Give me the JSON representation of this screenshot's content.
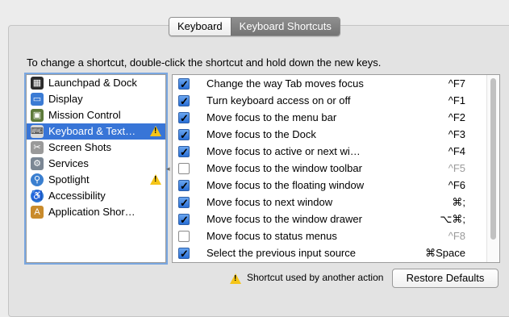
{
  "tabs": [
    {
      "label": "Keyboard",
      "active": false
    },
    {
      "label": "Keyboard Shortcuts",
      "active": true
    }
  ],
  "instruction": "To change a shortcut, double-click the shortcut and hold down the new keys.",
  "sidebar": {
    "items": [
      {
        "label": "Launchpad & Dock",
        "icon": "launchpad-icon",
        "warning": false,
        "selected": false
      },
      {
        "label": "Display",
        "icon": "display-icon",
        "warning": false,
        "selected": false
      },
      {
        "label": "Mission Control",
        "icon": "mission-control-icon",
        "warning": false,
        "selected": false
      },
      {
        "label": "Keyboard & Text…",
        "icon": "keyboard-icon",
        "warning": true,
        "selected": true
      },
      {
        "label": "Screen Shots",
        "icon": "screenshot-icon",
        "warning": false,
        "selected": false
      },
      {
        "label": "Services",
        "icon": "gear-icon",
        "warning": false,
        "selected": false
      },
      {
        "label": "Spotlight",
        "icon": "spotlight-icon",
        "warning": true,
        "selected": false
      },
      {
        "label": "Accessibility",
        "icon": "accessibility-icon",
        "warning": false,
        "selected": false
      },
      {
        "label": "Application Shor…",
        "icon": "app-shortcuts-icon",
        "warning": false,
        "selected": false
      }
    ]
  },
  "shortcuts": [
    {
      "checked": true,
      "action": "Change the way Tab moves focus",
      "keys": "^F7"
    },
    {
      "checked": true,
      "action": "Turn keyboard access on or off",
      "keys": "^F1"
    },
    {
      "checked": true,
      "action": "Move focus to the menu bar",
      "keys": "^F2"
    },
    {
      "checked": true,
      "action": "Move focus to the Dock",
      "keys": "^F3"
    },
    {
      "checked": true,
      "action": "Move focus to active or next wi…",
      "keys": "^F4"
    },
    {
      "checked": false,
      "action": "Move focus to the window toolbar",
      "keys": "^F5"
    },
    {
      "checked": true,
      "action": "Move focus to the floating window",
      "keys": "^F6"
    },
    {
      "checked": true,
      "action": "Move focus to next window",
      "keys": "⌘;"
    },
    {
      "checked": true,
      "action": "Move focus to the window drawer",
      "keys": "⌥⌘;"
    },
    {
      "checked": false,
      "action": "Move focus to status menus",
      "keys": "^F8"
    },
    {
      "checked": true,
      "action": "Select the previous input source",
      "keys": "⌘Space"
    }
  ],
  "footer": {
    "note": "Shortcut used by another action",
    "restore_label": "Restore Defaults"
  },
  "colors": {
    "selection": "#3875d7",
    "warning": "#f5c518",
    "checkbox": "#2a6fd6"
  }
}
